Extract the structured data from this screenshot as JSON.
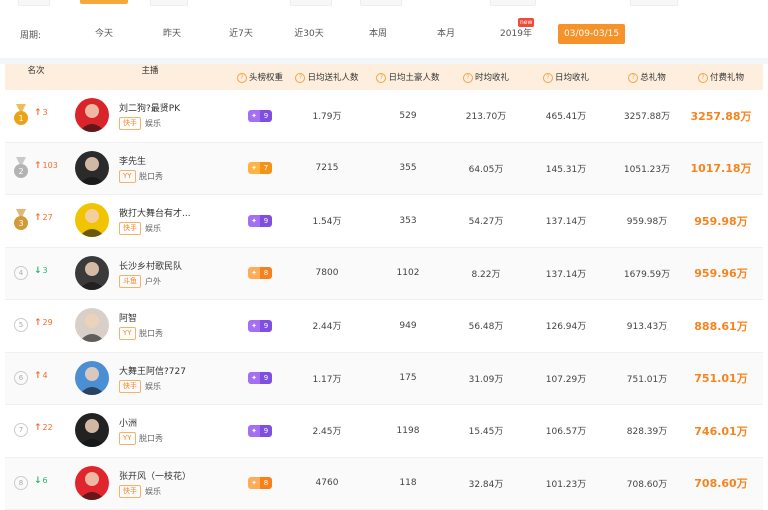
{
  "filters": {
    "period_label": "周期:",
    "period_options": [
      "今天",
      "昨天",
      "近7天",
      "近30天",
      "本周",
      "本月",
      "2019年",
      "03/09-03/15"
    ],
    "new_badge": "new",
    "active_period": "03/09-03/15"
  },
  "table": {
    "headers": {
      "rank": "名次",
      "anchor": "主播",
      "weight": "头榜权重",
      "daily_reward_users": "日均送礼人数",
      "daily_uploader": "日均土豪人数",
      "weekly_income": "时均收礼",
      "daily_income": "日均收礼",
      "total_gifts": "总礼物",
      "paid_gifts": "付费礼物"
    },
    "rows": [
      {
        "rank": "1",
        "medal": "gold",
        "trend": "up",
        "change": "3",
        "name": "刘二狗?最贤PK",
        "platform": "快手",
        "category": "娱乐",
        "weight_type": "purple",
        "weight": "9",
        "daily_reward_users": "1.79万",
        "daily_uploader": "529",
        "weekly_income": "213.70万",
        "daily_income": "465.41万",
        "total_gifts": "3257.88万",
        "paid_gifts": "3257.88万"
      },
      {
        "rank": "2",
        "medal": "silver",
        "trend": "up",
        "change": "103",
        "name": "李先生",
        "platform": "YY",
        "category": "脱口秀",
        "weight_type": "orange",
        "weight": "7",
        "daily_reward_users": "7215",
        "daily_uploader": "355",
        "weekly_income": "64.05万",
        "daily_income": "145.31万",
        "total_gifts": "1051.23万",
        "paid_gifts": "1017.18万"
      },
      {
        "rank": "3",
        "medal": "bronze",
        "trend": "up",
        "change": "27",
        "name": "散打大舞台有才...",
        "platform": "快手",
        "category": "娱乐",
        "weight_type": "purple",
        "weight": "9",
        "daily_reward_users": "1.54万",
        "daily_uploader": "353",
        "weekly_income": "54.27万",
        "daily_income": "137.14万",
        "total_gifts": "959.98万",
        "paid_gifts": "959.98万"
      },
      {
        "rank": "4",
        "medal": "",
        "trend": "down",
        "change": "3",
        "name": "长沙乡村歌民队",
        "platform": "斗鱼",
        "category": "户外",
        "weight_type": "orange2",
        "weight": "8",
        "daily_reward_users": "7800",
        "daily_uploader": "1102",
        "weekly_income": "8.22万",
        "daily_income": "137.14万",
        "total_gifts": "1679.59万",
        "paid_gifts": "959.96万"
      },
      {
        "rank": "5",
        "medal": "",
        "trend": "up",
        "change": "29",
        "name": "阿智",
        "platform": "YY",
        "category": "脱口秀",
        "weight_type": "purple",
        "weight": "9",
        "daily_reward_users": "2.44万",
        "daily_uploader": "949",
        "weekly_income": "56.48万",
        "daily_income": "126.94万",
        "total_gifts": "913.43万",
        "paid_gifts": "888.61万"
      },
      {
        "rank": "6",
        "medal": "",
        "trend": "up",
        "change": "4",
        "name": "大舞王阿信?727",
        "platform": "快手",
        "category": "娱乐",
        "weight_type": "purple",
        "weight": "9",
        "daily_reward_users": "1.17万",
        "daily_uploader": "175",
        "weekly_income": "31.09万",
        "daily_income": "107.29万",
        "total_gifts": "751.01万",
        "paid_gifts": "751.01万"
      },
      {
        "rank": "7",
        "medal": "",
        "trend": "up",
        "change": "22",
        "name": "小洲",
        "platform": "YY",
        "category": "脱口秀",
        "weight_type": "purple",
        "weight": "9",
        "daily_reward_users": "2.45万",
        "daily_uploader": "1198",
        "weekly_income": "15.45万",
        "daily_income": "106.57万",
        "total_gifts": "828.39万",
        "paid_gifts": "746.01万"
      },
      {
        "rank": "8",
        "medal": "",
        "trend": "down",
        "change": "6",
        "name": "张开风（一枝花）",
        "platform": "快手",
        "category": "娱乐",
        "weight_type": "orange2",
        "weight": "8",
        "daily_reward_users": "4760",
        "daily_uploader": "118",
        "weekly_income": "32.84万",
        "daily_income": "101.23万",
        "total_gifts": "708.60万",
        "paid_gifts": "708.60万"
      }
    ]
  },
  "colors": {
    "accent": "#f6922a",
    "header_bg": "#fdeedd",
    "paid": "#f6841e",
    "up": "#f26d2b",
    "down": "#2db273"
  }
}
